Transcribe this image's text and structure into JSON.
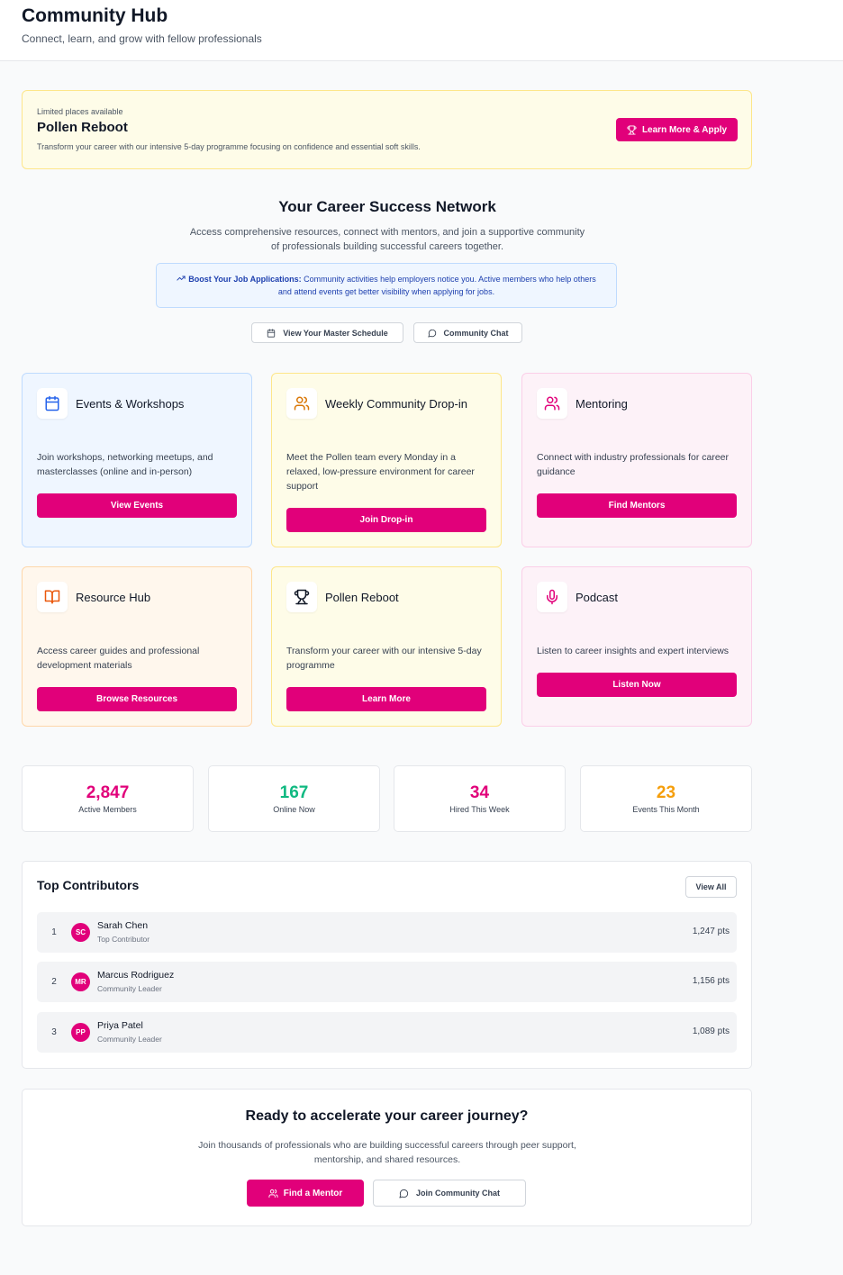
{
  "header": {
    "title": "Community Hub",
    "subtitle": "Connect, learn, and grow with fellow professionals"
  },
  "banner": {
    "eyebrow": "Limited places available",
    "title": "Pollen Reboot",
    "description": "Transform your career with our intensive 5-day programme focusing on confidence and essential soft skills.",
    "button_label": "Learn More & Apply"
  },
  "intro": {
    "title": "Your Career Success Network",
    "description": "Access comprehensive resources, connect with mentors, and join a supportive community of professionals building successful careers together.",
    "boost_title": "Boost Your Job Applications:",
    "boost_text": "Community activities help employers notice you. Active members who help others and attend events get better visibility when applying for jobs.",
    "schedule_button": "View Your Master Schedule",
    "chat_button": "Community Chat"
  },
  "cards": [
    {
      "title": "Events & Workshops",
      "description": "Join workshops, networking meetups, and masterclasses (online and in-person)",
      "button": "View Events",
      "icon": "calendar-icon"
    },
    {
      "title": "Weekly Community Drop-in",
      "description": "Meet the Pollen team every Monday in a relaxed, low-pressure environment for career support",
      "button": "Join Drop-in",
      "icon": "users-icon"
    },
    {
      "title": "Mentoring",
      "description": "Connect with industry professionals for career guidance",
      "button": "Find Mentors",
      "icon": "users-icon"
    },
    {
      "title": "Resource Hub",
      "description": "Access career guides and professional development materials",
      "button": "Browse Resources",
      "icon": "book-icon"
    },
    {
      "title": "Pollen Reboot",
      "description": "Transform your career with our intensive 5-day programme",
      "button": "Learn More",
      "icon": "trophy-icon"
    },
    {
      "title": "Podcast",
      "description": "Listen to career insights and expert interviews",
      "button": "Listen Now",
      "icon": "microphone-icon"
    }
  ],
  "stats": [
    {
      "value": "2,847",
      "label": "Active Members",
      "color": "#e1007a"
    },
    {
      "value": "167",
      "label": "Online Now",
      "color": "#10b981"
    },
    {
      "value": "34",
      "label": "Hired This Week",
      "color": "#e1007a"
    },
    {
      "value": "23",
      "label": "Events This Month",
      "color": "#f59e0b"
    }
  ],
  "contributors": {
    "title": "Top Contributors",
    "view_all": "View All",
    "items": [
      {
        "rank": "1",
        "initials": "SC",
        "name": "Sarah Chen",
        "role": "Top Contributor",
        "points": "1,247 pts"
      },
      {
        "rank": "2",
        "initials": "MR",
        "name": "Marcus Rodriguez",
        "role": "Community Leader",
        "points": "1,156 pts"
      },
      {
        "rank": "3",
        "initials": "PP",
        "name": "Priya Patel",
        "role": "Community Leader",
        "points": "1,089 pts"
      }
    ]
  },
  "cta": {
    "title": "Ready to accelerate your career journey?",
    "description": "Join thousands of professionals who are building successful careers through peer support, mentorship, and shared resources.",
    "primary_button": "Find a Mentor",
    "secondary_button": "Join Community Chat"
  },
  "colors": {
    "accent": "#e1007a"
  }
}
